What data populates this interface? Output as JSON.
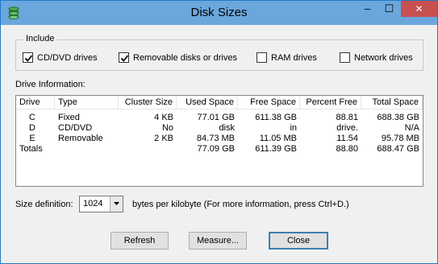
{
  "window": {
    "title": "Disk Sizes",
    "icon": "disk-stack-icon",
    "controls": {
      "minimize": "–",
      "maximize": "☐",
      "close": "✕"
    }
  },
  "include": {
    "legend": "Include",
    "options": [
      {
        "label": "CD/DVD drives",
        "checked": true
      },
      {
        "label": "Removable disks or drives",
        "checked": true
      },
      {
        "label": "RAM drives",
        "checked": false
      },
      {
        "label": "Network drives",
        "checked": false
      }
    ]
  },
  "drive_info": {
    "label": "Drive Information:",
    "columns": [
      "Drive",
      "Type",
      "Cluster Size",
      "Used Space",
      "Free Space",
      "Percent Free",
      "Total Space"
    ],
    "rows": [
      [
        "C",
        "Fixed",
        "4 KB",
        "77.01 GB",
        "611.38 GB",
        "88.81",
        "688.38 GB"
      ],
      [
        "D",
        "CD/DVD",
        "No",
        "disk",
        "in",
        "drive.",
        "N/A"
      ],
      [
        "E",
        "Removable",
        "2 KB",
        "84.73 MB",
        "11.05 MB",
        "11.54",
        "95.78 MB"
      ],
      [
        "Totals",
        "",
        "",
        "77.09 GB",
        "611.39 GB",
        "88.80",
        "688.47 GB"
      ]
    ]
  },
  "size_definition": {
    "label": "Size definition:",
    "value": "1024",
    "suffix": "bytes per kilobyte  (For more information, press Ctrl+D.)"
  },
  "buttons": {
    "refresh": "Refresh",
    "measure": "Measure...",
    "close": "Close"
  },
  "colors": {
    "title_bar": "#6ba7dd",
    "close_button": "#c75050",
    "window_bg": "#f0f0f0"
  }
}
